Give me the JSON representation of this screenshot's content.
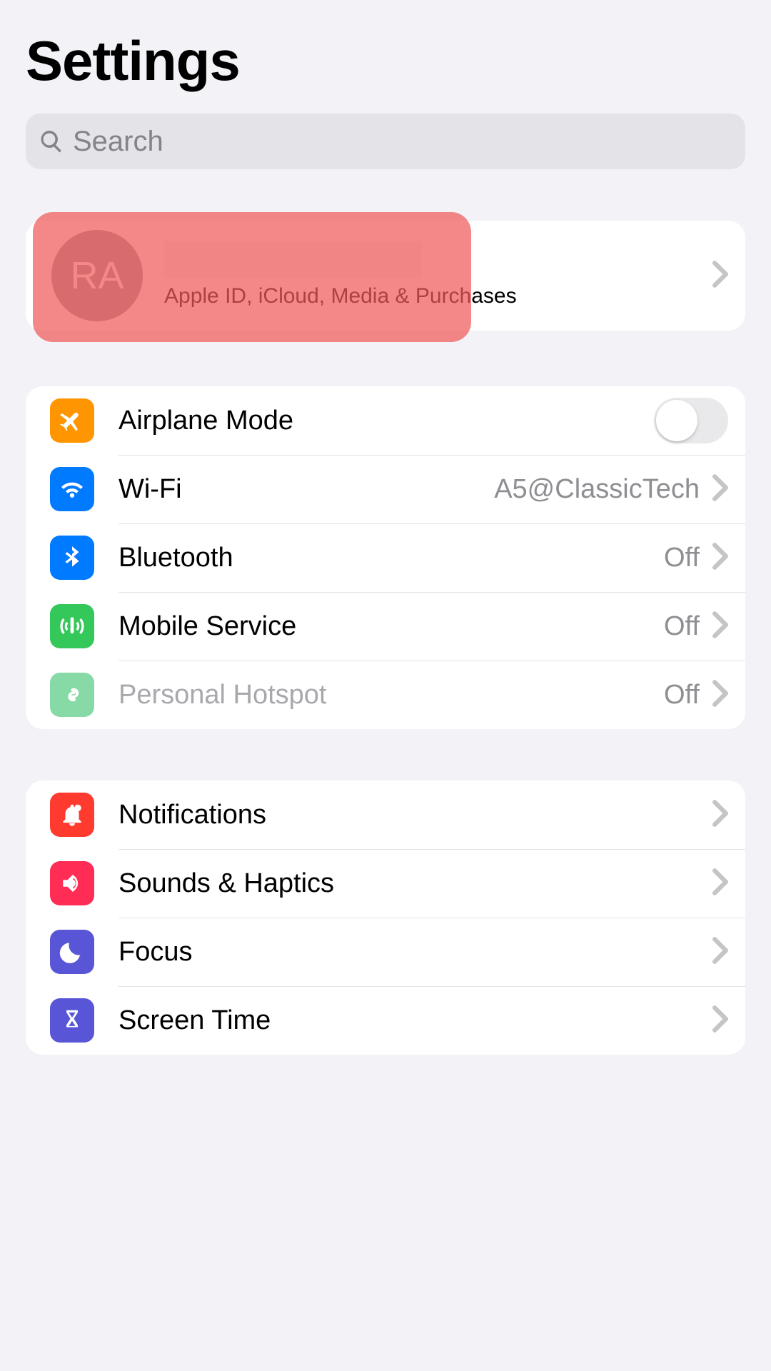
{
  "title": "Settings",
  "search_placeholder": "Search",
  "profile": {
    "initials": "RA",
    "subtitle": "Apple ID, iCloud, Media & Purchases"
  },
  "group1": {
    "airplane": "Airplane Mode",
    "wifi": "Wi-Fi",
    "wifi_value": "A5@ClassicTech",
    "bluetooth": "Bluetooth",
    "bluetooth_value": "Off",
    "mobile": "Mobile Service",
    "mobile_value": "Off",
    "hotspot": "Personal Hotspot",
    "hotspot_value": "Off"
  },
  "group2": {
    "notifications": "Notifications",
    "sounds": "Sounds & Haptics",
    "focus": "Focus",
    "screentime": "Screen Time"
  }
}
